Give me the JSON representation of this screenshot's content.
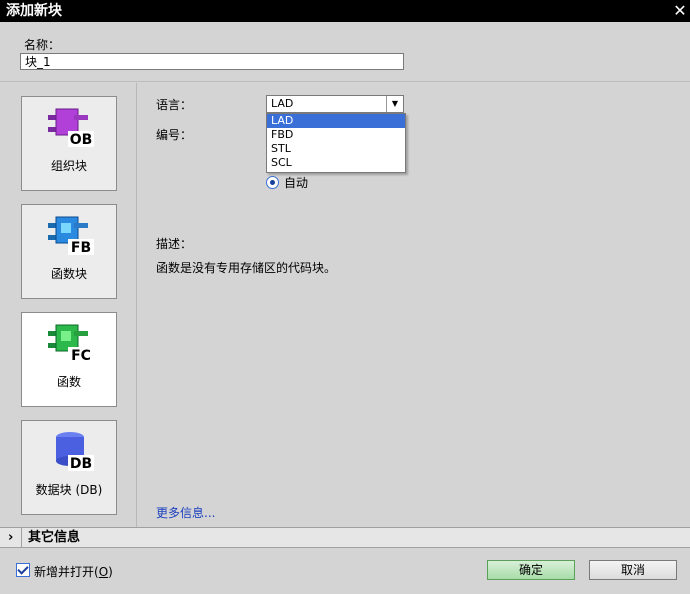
{
  "window": {
    "title": "添加新块",
    "close_glyph": "✕"
  },
  "header": {
    "name_label": "名称：",
    "name_value": "块_1"
  },
  "blocks": [
    {
      "icon": "ob-block-icon",
      "badge": "OB",
      "label": "组织块",
      "color": "#b040d8"
    },
    {
      "icon": "fb-block-icon",
      "badge": "FB",
      "label": "函数块",
      "color": "#2a8ae0"
    },
    {
      "icon": "fc-block-icon",
      "badge": "FC",
      "label": "函数",
      "color": "#2cb84a"
    },
    {
      "icon": "db-block-icon",
      "badge": "DB",
      "label": "数据块 (DB)",
      "color": "#4a60e0"
    }
  ],
  "form": {
    "language_label": "语言：",
    "language_value": "LAD",
    "language_options": [
      "LAD",
      "FBD",
      "STL",
      "SCL"
    ],
    "number_label": "编号：",
    "auto_label": "自动",
    "description_label": "描述：",
    "description_text": "函数是没有专用存储区的代码块。",
    "more_info": "更多信息..."
  },
  "section": {
    "chevron": "›",
    "label": "其它信息"
  },
  "footer": {
    "add_open_label": "新增并打开(",
    "add_open_key": "O",
    "add_open_suffix": ")",
    "ok_label": "确定",
    "cancel_label": "取消"
  },
  "colors": {
    "accent": "#3a6fd8",
    "link": "#1a3fbf",
    "ok_button": "#a8dca8"
  }
}
